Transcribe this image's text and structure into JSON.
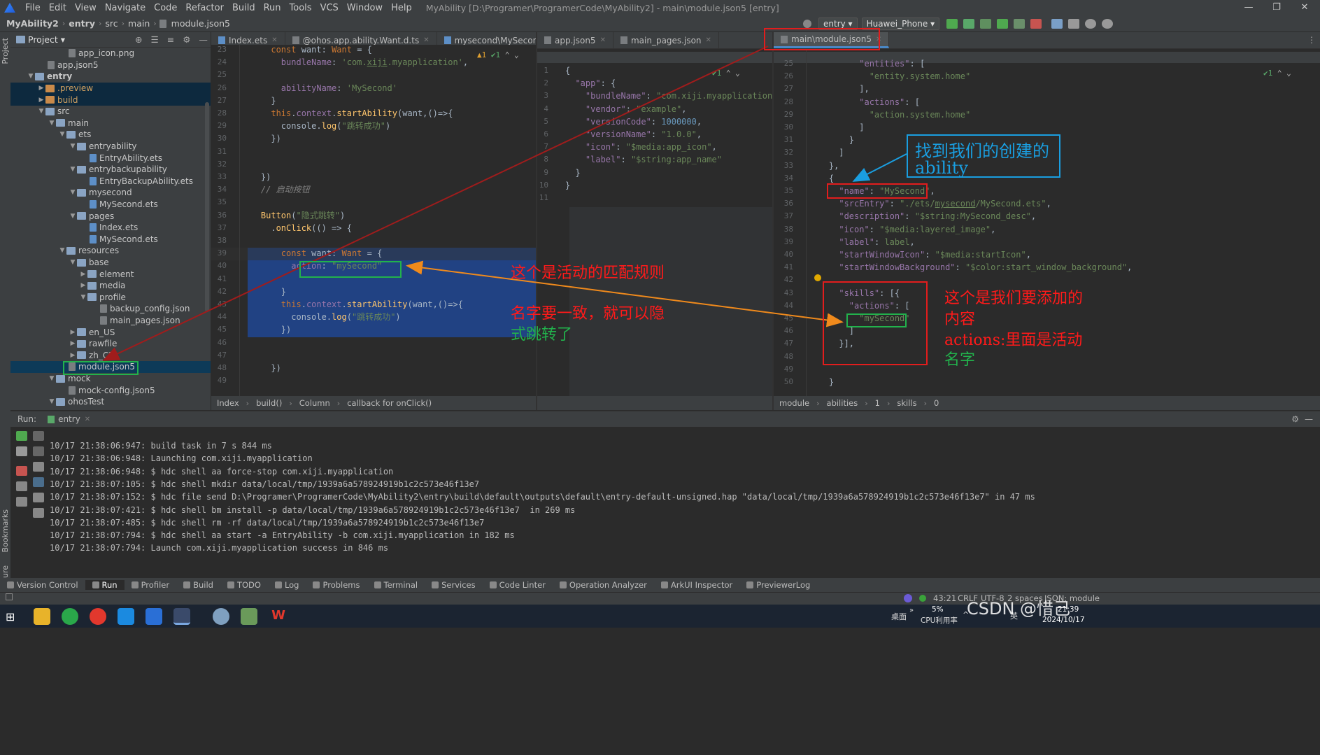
{
  "window": {
    "menu": [
      "File",
      "Edit",
      "View",
      "Navigate",
      "Code",
      "Refactor",
      "Build",
      "Run",
      "Tools",
      "VCS",
      "Window",
      "Help"
    ],
    "title": "MyAbility [D:\\Programer\\ProgramerCode\\MyAbility2] - main\\module.json5 [entry]",
    "minimize": "—",
    "restore": "❐",
    "close": "✕"
  },
  "navbar": {
    "crumbs": [
      "MyAbility2",
      "entry",
      "src",
      "main",
      "module.json5"
    ],
    "run_config": "entry",
    "device": "Huawei_Phone"
  },
  "sidebar_strip": {
    "project": "Project",
    "bookmarks": "Bookmarks",
    "structure": "Structure"
  },
  "project": {
    "header": "Project",
    "tree": [
      {
        "label": "app_icon.png",
        "depth": 5,
        "kind": "file"
      },
      {
        "label": "app.json5",
        "depth": 3,
        "kind": "file"
      },
      {
        "label": "entry",
        "depth": 1,
        "kind": "folder",
        "open": true,
        "bold": true
      },
      {
        "label": ".preview",
        "depth": 2,
        "kind": "folder-orange",
        "open": false
      },
      {
        "label": "build",
        "depth": 2,
        "kind": "folder-orange",
        "open": false
      },
      {
        "label": "src",
        "depth": 2,
        "kind": "folder",
        "open": true
      },
      {
        "label": "main",
        "depth": 3,
        "kind": "folder",
        "open": true
      },
      {
        "label": "ets",
        "depth": 4,
        "kind": "folder",
        "open": true
      },
      {
        "label": "entryability",
        "depth": 5,
        "kind": "folder",
        "open": true
      },
      {
        "label": "EntryAbility.ets",
        "depth": 7,
        "kind": "ets"
      },
      {
        "label": "entrybackupability",
        "depth": 5,
        "kind": "folder",
        "open": true
      },
      {
        "label": "EntryBackupAbility.ets",
        "depth": 7,
        "kind": "ets"
      },
      {
        "label": "mysecond",
        "depth": 5,
        "kind": "folder",
        "open": true
      },
      {
        "label": "MySecond.ets",
        "depth": 7,
        "kind": "ets"
      },
      {
        "label": "pages",
        "depth": 5,
        "kind": "folder",
        "open": true
      },
      {
        "label": "Index.ets",
        "depth": 7,
        "kind": "ets"
      },
      {
        "label": "MySecond.ets",
        "depth": 7,
        "kind": "ets"
      },
      {
        "label": "resources",
        "depth": 4,
        "kind": "folder",
        "open": true
      },
      {
        "label": "base",
        "depth": 5,
        "kind": "folder",
        "open": true
      },
      {
        "label": "element",
        "depth": 6,
        "kind": "folder",
        "open": false
      },
      {
        "label": "media",
        "depth": 6,
        "kind": "folder",
        "open": false
      },
      {
        "label": "profile",
        "depth": 6,
        "kind": "folder",
        "open": true
      },
      {
        "label": "backup_config.json",
        "depth": 8,
        "kind": "file"
      },
      {
        "label": "main_pages.json",
        "depth": 8,
        "kind": "file"
      },
      {
        "label": "en_US",
        "depth": 5,
        "kind": "folder",
        "open": false
      },
      {
        "label": "rawfile",
        "depth": 5,
        "kind": "folder",
        "open": false
      },
      {
        "label": "zh_CN",
        "depth": 5,
        "kind": "folder",
        "open": false
      },
      {
        "label": "module.json5",
        "depth": 5,
        "kind": "file",
        "selected": true
      },
      {
        "label": "mock",
        "depth": 3,
        "kind": "folder",
        "open": true
      },
      {
        "label": "mock-config.json5",
        "depth": 5,
        "kind": "file"
      },
      {
        "label": "ohosTest",
        "depth": 3,
        "kind": "folder",
        "open": true
      }
    ]
  },
  "editor1": {
    "tabs": [
      "Index.ets",
      "@ohos.app.ability.Want.d.ts",
      "mysecond\\MySecond.ets"
    ],
    "inspection": "▲1 ✔1",
    "line_numbers": [
      "23",
      "24",
      "25",
      "26",
      "27",
      "28",
      "29",
      "30",
      "31",
      "32",
      "33",
      "34",
      "35",
      "36",
      "37",
      "38",
      "39",
      "40",
      "41",
      "42",
      "43",
      "44",
      "45",
      "46",
      "47",
      "48",
      "49"
    ],
    "breadcrumb": [
      "Index",
      "build()",
      "Column",
      "callback for onClick()"
    ]
  },
  "editor2": {
    "tabs": [
      "app.json5",
      "main_pages.json"
    ],
    "inspection": "✔1",
    "line_numbers": [
      "1",
      "2",
      "3",
      "4",
      "5",
      "6",
      "7",
      "8",
      "9",
      "10",
      "11"
    ]
  },
  "editor3": {
    "tabs": [
      "main\\module.json5"
    ],
    "inspection": "✔1",
    "line_numbers": [
      "25",
      "26",
      "27",
      "28",
      "29",
      "30",
      "31",
      "32",
      "33",
      "34",
      "35",
      "36",
      "37",
      "38",
      "39",
      "40",
      "41",
      "42",
      "43",
      "44",
      "45",
      "46",
      "47",
      "48",
      "49",
      "50"
    ],
    "breadcrumb": [
      "module",
      "abilities",
      "1",
      "skills",
      "0"
    ]
  },
  "run": {
    "label": "Run:",
    "config": "entry",
    "lines": [
      "10/17 21:38:06:947: build task in 7 s 844 ms",
      "10/17 21:38:06:948: Launching com.xiji.myapplication",
      "10/17 21:38:06:948: $ hdc shell aa force-stop com.xiji.myapplication",
      "10/17 21:38:07:105: $ hdc shell mkdir data/local/tmp/1939a6a578924919b1c2c573e46f13e7",
      "10/17 21:38:07:152: $ hdc file send D:\\Programer\\ProgramerCode\\MyAbility2\\entry\\build\\default\\outputs\\default\\entry-default-unsigned.hap \"data/local/tmp/1939a6a578924919b1c2c573e46f13e7\" in 47 ms",
      "10/17 21:38:07:421: $ hdc shell bm install -p data/local/tmp/1939a6a578924919b1c2c573e46f13e7  in 269 ms",
      "10/17 21:38:07:485: $ hdc shell rm -rf data/local/tmp/1939a6a578924919b1c2c573e46f13e7",
      "10/17 21:38:07:794: $ hdc shell aa start -a EntryAbility -b com.xiji.myapplication in 182 ms",
      "10/17 21:38:07:794: Launch com.xiji.myapplication success in 846 ms"
    ]
  },
  "toolwindows": [
    "Version Control",
    "Run",
    "Profiler",
    "Build",
    "TODO",
    "Log",
    "Problems",
    "Terminal",
    "Services",
    "Code Linter",
    "Operation Analyzer",
    "ArkUI Inspector",
    "PreviewerLog"
  ],
  "status": {
    "position": "43:21",
    "line_sep": "CRLF",
    "encoding": "UTF-8",
    "indent": "2 spaces",
    "schema": "JSON: module"
  },
  "taskbar": {
    "desktop": "桌面",
    "cpu_percent": "5%",
    "cpu_label": "CPU利用率",
    "time": "21:39",
    "date": "2024/10/17",
    "ime": "英",
    "watermark": "CSDN @惜己"
  },
  "annotations": {
    "rule": "这个是活动的匹配规则",
    "same_name_1": "名字要一致，就可以隐",
    "same_name_2": "式跳转了",
    "find_1": "找到我们的创建的",
    "find_2": "ability",
    "add_1": "这个是我们要添加的",
    "add_2": "内容",
    "add_3": "actions:里面是活动",
    "add_4": "名字"
  },
  "colors": {
    "red": "#e21d1d",
    "green": "#22b24c",
    "blue": "#1a9ee0",
    "orange": "#f08a1c",
    "darkred": "#a01c1c"
  }
}
